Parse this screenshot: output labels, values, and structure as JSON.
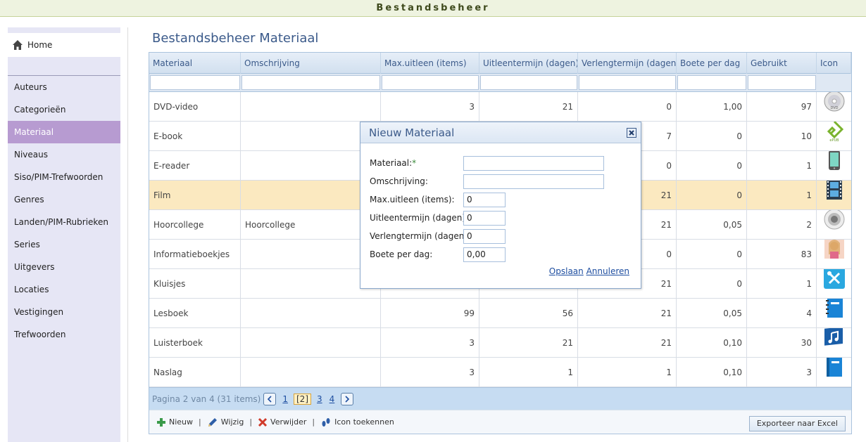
{
  "app_title": "Bestandsbeheer",
  "sidebar": {
    "home": "Home",
    "items": [
      {
        "label": "Auteurs"
      },
      {
        "label": "Categorieën"
      },
      {
        "label": "Materiaal",
        "active": true
      },
      {
        "label": "Niveaus"
      },
      {
        "label": "Siso/PIM-Trefwoorden"
      },
      {
        "label": "Genres"
      },
      {
        "label": "Landen/PIM-Rubrieken"
      },
      {
        "label": "Series"
      },
      {
        "label": "Uitgevers"
      },
      {
        "label": "Locaties"
      },
      {
        "label": "Vestigingen"
      },
      {
        "label": "Trefwoorden"
      }
    ]
  },
  "page_title": "Bestandsbeheer Materiaal",
  "table": {
    "columns": [
      "Materiaal",
      "Omschrijving",
      "Max.uitleen (items)",
      "Uitleentermijn (dagen)",
      "Verlengtermijn (dagen)",
      "Boete per dag",
      "Gebruikt",
      "Icon"
    ],
    "rows": [
      {
        "materiaal": "DVD-video",
        "omschrijving": "",
        "max": "3",
        "uitleen": "21",
        "verleng": "0",
        "boete": "1,00",
        "gebruikt": "97",
        "icon": "dvd-icon"
      },
      {
        "materiaal": "E-book",
        "omschrijving": "",
        "max": "",
        "uitleen": "",
        "verleng": "7",
        "boete": "0",
        "gebruikt": "10",
        "icon": "epub-icon"
      },
      {
        "materiaal": "E-reader",
        "omschrijving": "",
        "max": "",
        "uitleen": "",
        "verleng": "0",
        "boete": "0",
        "gebruikt": "1",
        "icon": "phone-icon"
      },
      {
        "materiaal": "Film",
        "omschrijving": "",
        "max": "",
        "uitleen": "",
        "verleng": "21",
        "boete": "0",
        "gebruikt": "1",
        "icon": "film-icon",
        "highlight": true
      },
      {
        "materiaal": "Hoorcollege",
        "omschrijving": "Hoorcollege",
        "max": "",
        "uitleen": "",
        "verleng": "21",
        "boete": "0,05",
        "gebruikt": "2",
        "icon": "speaker-icon"
      },
      {
        "materiaal": "Informatieboekjes",
        "omschrijving": "",
        "max": "",
        "uitleen": "",
        "verleng": "0",
        "boete": "0",
        "gebruikt": "83",
        "icon": "magazine-icon"
      },
      {
        "materiaal": "Kluisjes",
        "omschrijving": "",
        "max": "",
        "uitleen": "",
        "verleng": "21",
        "boete": "0",
        "gebruikt": "1",
        "icon": "tools-icon"
      },
      {
        "materiaal": "Lesboek",
        "omschrijving": "",
        "max": "99",
        "uitleen": "56",
        "verleng": "21",
        "boete": "0,05",
        "gebruikt": "4",
        "icon": "notebook-icon"
      },
      {
        "materiaal": "Luisterboek",
        "omschrijving": "",
        "max": "3",
        "uitleen": "21",
        "verleng": "21",
        "boete": "0,10",
        "gebruikt": "30",
        "icon": "music-icon"
      },
      {
        "materiaal": "Naslag",
        "omschrijving": "",
        "max": "3",
        "uitleen": "1",
        "verleng": "1",
        "boete": "0,10",
        "gebruikt": "3",
        "icon": "book-icon"
      }
    ]
  },
  "pager": {
    "summary": "Pagina 2 van 4 (31 items)",
    "pages": [
      "1",
      "[2]",
      "3",
      "4"
    ],
    "current": "[2]"
  },
  "toolbar": {
    "new": "Nieuw",
    "edit": "Wijzig",
    "delete": "Verwijder",
    "icon": "Icon toekennen",
    "export": "Exporteer naar Excel"
  },
  "dialog": {
    "title": "Nieuw Materiaal",
    "fields": [
      {
        "label": "Materiaal:",
        "value": "",
        "required": true
      },
      {
        "label": "Omschrijving:",
        "value": ""
      },
      {
        "label": "Max.uitleen (items):",
        "value": "0"
      },
      {
        "label": "Uitleentermijn (dagen):",
        "value": "0"
      },
      {
        "label": "Verlengtermijn (dagen):",
        "value": "0"
      },
      {
        "label": "Boete per dag:",
        "value": "0,00"
      }
    ],
    "save": "Opslaan",
    "cancel": "Annuleren"
  }
}
